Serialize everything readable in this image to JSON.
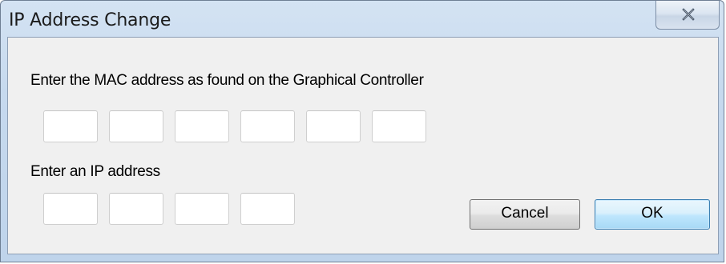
{
  "window": {
    "title": "IP Address Change",
    "close_glyph": "✕"
  },
  "mac": {
    "label": "Enter the MAC address as found on the Graphical Controller",
    "fields": [
      "",
      "",
      "",
      "",
      "",
      ""
    ]
  },
  "ip": {
    "label": "Enter an IP address",
    "fields": [
      "",
      "",
      "",
      ""
    ]
  },
  "buttons": {
    "cancel_label": "Cancel",
    "ok_label": "OK"
  },
  "colors": {
    "title_bar": "#c6d9ee",
    "client_bg": "#f0f0f0",
    "default_button_border": "#3c7fb1"
  }
}
